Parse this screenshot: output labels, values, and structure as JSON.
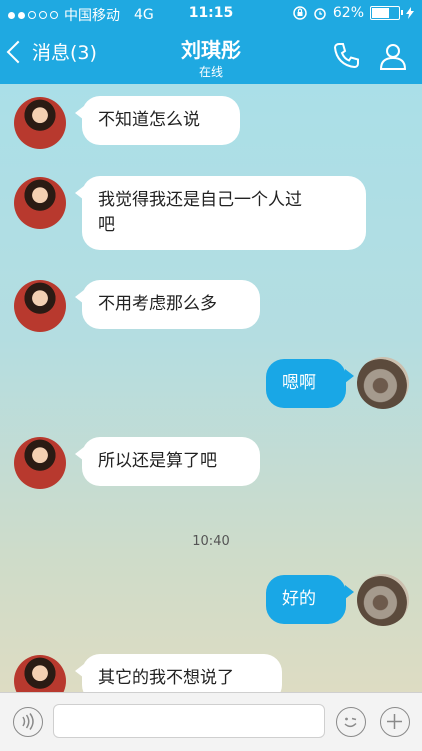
{
  "status_bar": {
    "carrier": "中国移动",
    "network": "4G",
    "time": "11:15",
    "battery_percent": "62%",
    "signal_bars": 2
  },
  "nav": {
    "back_label": "消息(3)",
    "title": "刘琪彤",
    "subtitle": "在线",
    "icons": [
      "phone-icon",
      "contact-icon"
    ]
  },
  "messages": [
    {
      "side": "in",
      "text": "不知道怎么说"
    },
    {
      "side": "in",
      "text": "我觉得我还是自己一个人过\n吧"
    },
    {
      "side": "in",
      "text": "不用考虑那么多"
    },
    {
      "side": "out",
      "text": "嗯啊"
    },
    {
      "side": "in",
      "text": "所以还是算了吧"
    },
    {
      "side": "out",
      "text": "好的"
    },
    {
      "side": "in",
      "text": "其它的我不想说了"
    }
  ],
  "timestamp": "10:40",
  "input_bar": {
    "placeholder": "",
    "icons": [
      "voice-icon",
      "emoji-icon",
      "add-icon"
    ]
  },
  "colors": {
    "nav_background": "#1fa9e1",
    "outgoing_bubble": "#19a7e6",
    "incoming_bubble": "#ffffff"
  }
}
